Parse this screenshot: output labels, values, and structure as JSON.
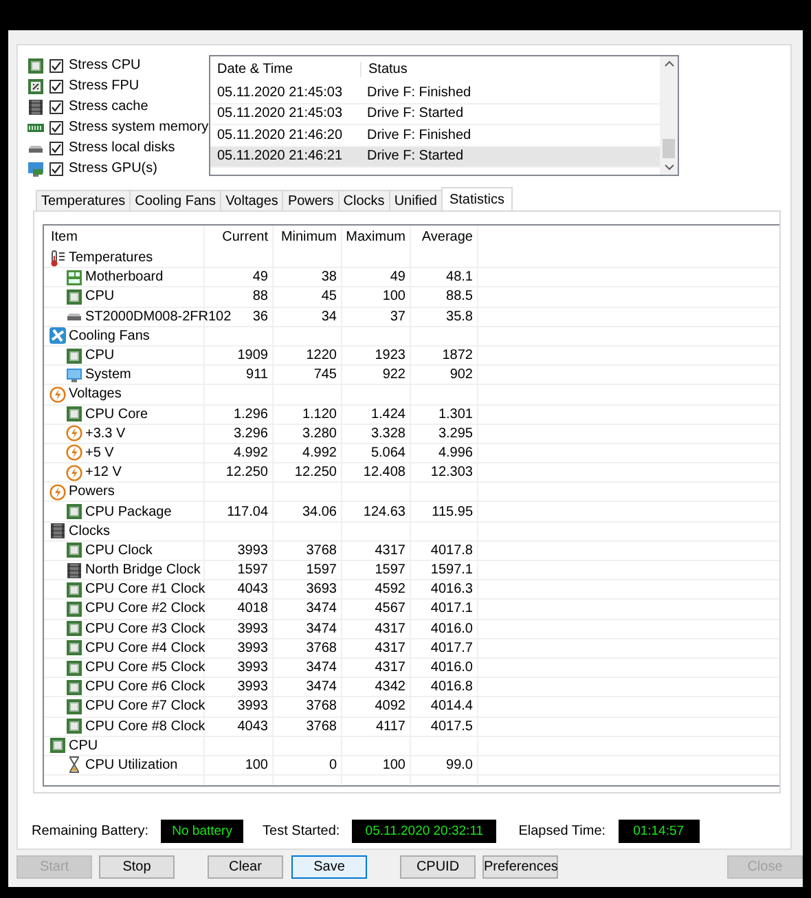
{
  "stress_options": [
    {
      "label": "Stress CPU",
      "checked": true,
      "kind": "chip"
    },
    {
      "label": "Stress FPU",
      "checked": true,
      "kind": "fpu"
    },
    {
      "label": "Stress cache",
      "checked": true,
      "kind": "dark-chip"
    },
    {
      "label": "Stress system memory",
      "checked": true,
      "kind": "memory"
    },
    {
      "label": "Stress local disks",
      "checked": true,
      "kind": "disk"
    },
    {
      "label": "Stress GPU(s)",
      "checked": true,
      "kind": "gpu"
    }
  ],
  "log": {
    "columns": [
      "Date & Time",
      "Status"
    ],
    "rows": [
      {
        "time": "05.11.2020 21:45:03",
        "status": "Drive F: Finished",
        "selected": false
      },
      {
        "time": "05.11.2020 21:45:03",
        "status": "Drive F: Started",
        "selected": false
      },
      {
        "time": "05.11.2020 21:46:20",
        "status": "Drive F: Finished",
        "selected": false
      },
      {
        "time": "05.11.2020 21:46:21",
        "status": "Drive F: Started",
        "selected": true
      }
    ]
  },
  "tabs": [
    {
      "label": "Temperatures",
      "selected": false
    },
    {
      "label": "Cooling Fans",
      "selected": false
    },
    {
      "label": "Voltages",
      "selected": false
    },
    {
      "label": "Powers",
      "selected": false
    },
    {
      "label": "Clocks",
      "selected": false
    },
    {
      "label": "Unified",
      "selected": false
    },
    {
      "label": "Statistics",
      "selected": true
    }
  ],
  "statistics": {
    "columns": [
      "Item",
      "Current",
      "Minimum",
      "Maximum",
      "Average"
    ],
    "groups": [
      {
        "label": "Temperatures",
        "kind": "thermometer",
        "children": [
          {
            "label": "Motherboard",
            "kind": "board",
            "values": [
              "49",
              "38",
              "49",
              "48.1"
            ]
          },
          {
            "label": "CPU",
            "kind": "chip",
            "values": [
              "88",
              "45",
              "100",
              "88.5"
            ]
          },
          {
            "label": "ST2000DM008-2FR102",
            "kind": "disk",
            "values": [
              "36",
              "34",
              "37",
              "35.8"
            ]
          }
        ]
      },
      {
        "label": "Cooling Fans",
        "kind": "fan",
        "children": [
          {
            "label": "CPU",
            "kind": "chip",
            "values": [
              "1909",
              "1220",
              "1923",
              "1872"
            ]
          },
          {
            "label": "System",
            "kind": "monitor",
            "values": [
              "911",
              "745",
              "922",
              "902"
            ]
          }
        ]
      },
      {
        "label": "Voltages",
        "kind": "bolt",
        "children": [
          {
            "label": "CPU Core",
            "kind": "chip",
            "values": [
              "1.296",
              "1.120",
              "1.424",
              "1.301"
            ]
          },
          {
            "label": "+3.3 V",
            "kind": "bolt",
            "values": [
              "3.296",
              "3.280",
              "3.328",
              "3.295"
            ]
          },
          {
            "label": "+5 V",
            "kind": "bolt",
            "values": [
              "4.992",
              "4.992",
              "5.064",
              "4.996"
            ]
          },
          {
            "label": "+12 V",
            "kind": "bolt",
            "values": [
              "12.250",
              "12.250",
              "12.408",
              "12.303"
            ]
          }
        ]
      },
      {
        "label": "Powers",
        "kind": "bolt",
        "children": [
          {
            "label": "CPU Package",
            "kind": "chip",
            "values": [
              "117.04",
              "34.06",
              "124.63",
              "115.95"
            ]
          }
        ]
      },
      {
        "label": "Clocks",
        "kind": "dark-chip",
        "children": [
          {
            "label": "CPU Clock",
            "kind": "chip",
            "values": [
              "3993",
              "3768",
              "4317",
              "4017.8"
            ]
          },
          {
            "label": "North Bridge Clock",
            "kind": "dark-chip",
            "values": [
              "1597",
              "1597",
              "1597",
              "1597.1"
            ]
          },
          {
            "label": "CPU Core #1 Clock",
            "kind": "chip",
            "values": [
              "4043",
              "3693",
              "4592",
              "4016.3"
            ]
          },
          {
            "label": "CPU Core #2 Clock",
            "kind": "chip",
            "values": [
              "4018",
              "3474",
              "4567",
              "4017.1"
            ]
          },
          {
            "label": "CPU Core #3 Clock",
            "kind": "chip",
            "values": [
              "3993",
              "3474",
              "4317",
              "4016.0"
            ]
          },
          {
            "label": "CPU Core #4 Clock",
            "kind": "chip",
            "values": [
              "3993",
              "3768",
              "4317",
              "4017.7"
            ]
          },
          {
            "label": "CPU Core #5 Clock",
            "kind": "chip",
            "values": [
              "3993",
              "3474",
              "4317",
              "4016.0"
            ]
          },
          {
            "label": "CPU Core #6 Clock",
            "kind": "chip",
            "values": [
              "3993",
              "3474",
              "4342",
              "4016.8"
            ]
          },
          {
            "label": "CPU Core #7 Clock",
            "kind": "chip",
            "values": [
              "3993",
              "3768",
              "4092",
              "4014.4"
            ]
          },
          {
            "label": "CPU Core #8 Clock",
            "kind": "chip",
            "values": [
              "4043",
              "3768",
              "4117",
              "4017.5"
            ]
          }
        ]
      },
      {
        "label": "CPU",
        "kind": "chip",
        "children": [
          {
            "label": "CPU Utilization",
            "kind": "hourglass",
            "values": [
              "100",
              "0",
              "100",
              "99.0"
            ]
          }
        ]
      }
    ]
  },
  "status": [
    {
      "label": "Remaining Battery:",
      "value": "No battery"
    },
    {
      "label": "Test Started:",
      "value": "05.11.2020 20:32:11"
    },
    {
      "label": "Elapsed Time:",
      "value": "01:14:57"
    }
  ],
  "buttons": [
    {
      "label": "Start",
      "disabled": true,
      "default": false
    },
    {
      "label": "Stop",
      "disabled": false,
      "default": false
    },
    {
      "label": "Clear",
      "disabled": false,
      "default": false
    },
    {
      "label": "Save",
      "disabled": false,
      "default": true
    },
    {
      "label": "CPUID",
      "disabled": false,
      "default": false
    },
    {
      "label": "Preferences",
      "disabled": false,
      "default": false
    },
    {
      "label": "Close",
      "disabled": true,
      "default": false
    }
  ]
}
